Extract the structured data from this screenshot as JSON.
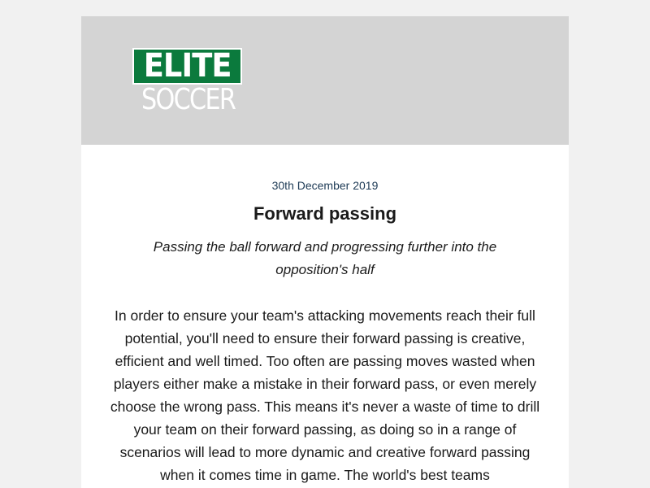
{
  "logo": {
    "line1": "ELITE",
    "line2": "SOCCER"
  },
  "article": {
    "date": "30th December 2019",
    "title": "Forward passing",
    "subtitle": "Passing the ball forward and progressing further into the opposition's half",
    "body": "In order to ensure your team's attacking movements reach their full potential, you'll need to ensure their forward passing is creative, efficient and well timed. Too often are passing moves wasted when players either make a mistake in their forward pass, or even merely choose the wrong pass. This means it's never a waste of time to drill your team on their forward passing, as doing so in a range of scenarios will lead to more dynamic and creative forward passing when it comes time in game. The world's best teams"
  },
  "colors": {
    "page_background": "#f1f1f1",
    "header_background": "#d4d4d4",
    "brand_green": "#0b7a3d",
    "date_text": "#1d3a55"
  }
}
